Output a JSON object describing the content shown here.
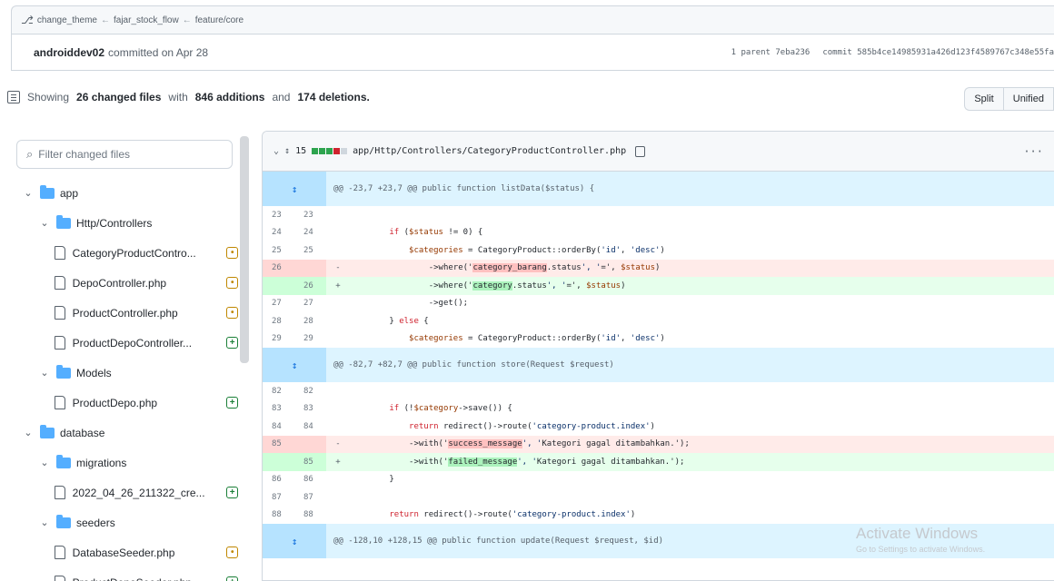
{
  "breadcrumb": {
    "icon": "branch-icon",
    "items": [
      "change_theme",
      "fajar_stock_flow",
      "feature/core"
    ],
    "separator": "←"
  },
  "commit": {
    "author": "androiddev02",
    "action": "committed on Apr 28",
    "parent": "1 parent 7eba236",
    "hash": "commit 585b4ce14985931a426d123f4589767c348e55fa"
  },
  "summary": {
    "prefix": "Showing",
    "files": "26 changed files",
    "with": "with",
    "additions": "846 additions",
    "and": "and",
    "deletions": "174 deletions."
  },
  "view": {
    "split": "Split",
    "unified": "Unified"
  },
  "filter": {
    "placeholder": "Filter changed files"
  },
  "tree": [
    {
      "type": "folder",
      "level": 0,
      "label": "app"
    },
    {
      "type": "folder",
      "level": 1,
      "label": "Http/Controllers"
    },
    {
      "type": "file",
      "level": 2,
      "label": "CategoryProductContro...",
      "status": "mod"
    },
    {
      "type": "file",
      "level": 2,
      "label": "DepoController.php",
      "status": "mod"
    },
    {
      "type": "file",
      "level": 2,
      "label": "ProductController.php",
      "status": "mod"
    },
    {
      "type": "file",
      "level": 2,
      "label": "ProductDepoController...",
      "status": "add"
    },
    {
      "type": "folder",
      "level": 1,
      "label": "Models"
    },
    {
      "type": "file",
      "level": 2,
      "label": "ProductDepo.php",
      "status": "add"
    },
    {
      "type": "folder",
      "level": 0,
      "label": "database"
    },
    {
      "type": "folder",
      "level": 1,
      "label": "migrations"
    },
    {
      "type": "file",
      "level": 2,
      "label": "2022_04_26_211322_cre...",
      "status": "add"
    },
    {
      "type": "folder",
      "level": 1,
      "label": "seeders"
    },
    {
      "type": "file",
      "level": 2,
      "label": "DatabaseSeeder.php",
      "status": "mod"
    },
    {
      "type": "file",
      "level": 2,
      "label": "ProductDepoSeeder.php",
      "status": "add"
    }
  ],
  "file_header": {
    "count": "15",
    "path": "app/Http/Controllers/CategoryProductController.php",
    "more": "···"
  },
  "diff": [
    {
      "kind": "hunk",
      "text": "@@ -23,7 +23,7 @@ public function listData($status) {"
    },
    {
      "kind": "ctx",
      "old": "23",
      "new": "23",
      "text": ""
    },
    {
      "kind": "ctx",
      "old": "24",
      "new": "24",
      "text": "        if ($status != 0) {"
    },
    {
      "kind": "ctx",
      "old": "25",
      "new": "25",
      "text": "            $categories = CategoryProduct::orderBy('id', 'desc')"
    },
    {
      "kind": "del",
      "old": "26",
      "new": "",
      "pre": "                ->where('",
      "hl": "category_barang",
      "post": ".status', '=', $status)"
    },
    {
      "kind": "add",
      "old": "",
      "new": "26",
      "pre": "                ->where('",
      "hl": "category",
      "post": ".status', '=', $status)"
    },
    {
      "kind": "ctx",
      "old": "27",
      "new": "27",
      "text": "                ->get();"
    },
    {
      "kind": "ctx",
      "old": "28",
      "new": "28",
      "text": "        } else {"
    },
    {
      "kind": "ctx",
      "old": "29",
      "new": "29",
      "text": "            $categories = CategoryProduct::orderBy('id', 'desc')"
    },
    {
      "kind": "hunk",
      "text": "@@ -82,7 +82,7 @@ public function store(Request $request)"
    },
    {
      "kind": "ctx",
      "old": "82",
      "new": "82",
      "text": ""
    },
    {
      "kind": "ctx",
      "old": "83",
      "new": "83",
      "text": "        if (!$category->save()) {"
    },
    {
      "kind": "ctx",
      "old": "84",
      "new": "84",
      "text": "            return redirect()->route('category-product.index')"
    },
    {
      "kind": "del",
      "old": "85",
      "new": "",
      "pre": "            ->with('",
      "hl": "success_message",
      "post": "', 'Kategori gagal ditambahkan.');"
    },
    {
      "kind": "add",
      "old": "",
      "new": "85",
      "pre": "            ->with('",
      "hl": "failed_message",
      "post": "', 'Kategori gagal ditambahkan.');"
    },
    {
      "kind": "ctx",
      "old": "86",
      "new": "86",
      "text": "        }"
    },
    {
      "kind": "ctx",
      "old": "87",
      "new": "87",
      "text": ""
    },
    {
      "kind": "ctx",
      "old": "88",
      "new": "88",
      "text": "        return redirect()->route('category-product.index')"
    },
    {
      "kind": "hunk",
      "text": "@@ -128,10 +128,15 @@ public function update(Request $request, $id)"
    }
  ],
  "watermark": {
    "title": "Activate Windows",
    "subtitle": "Go to Settings to activate Windows."
  },
  "colors": {
    "addition": "#2da44e",
    "deletion": "#cf222e",
    "accent": "#0969da"
  }
}
